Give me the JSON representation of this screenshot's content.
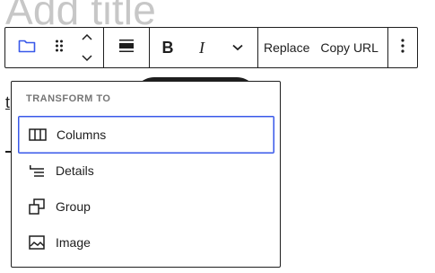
{
  "editor": {
    "title_placeholder": "Add title",
    "link_fragment": "t"
  },
  "toolbar": {
    "block_icon": "image-icon",
    "replace_label": "Replace",
    "copy_url_label": "Copy URL",
    "bold_label": "B",
    "italic_label": "I"
  },
  "transform_menu": {
    "heading": "TRANSFORM TO",
    "items": [
      {
        "label": "Columns",
        "icon": "columns-icon",
        "active": true
      },
      {
        "label": "Details",
        "icon": "details-icon",
        "active": false
      },
      {
        "label": "Group",
        "icon": "group-icon",
        "active": false
      },
      {
        "label": "Image",
        "icon": "image-icon",
        "active": false
      }
    ]
  },
  "colors": {
    "accent": "#3858e9",
    "text": "#1e1e1e",
    "muted": "#757575"
  }
}
